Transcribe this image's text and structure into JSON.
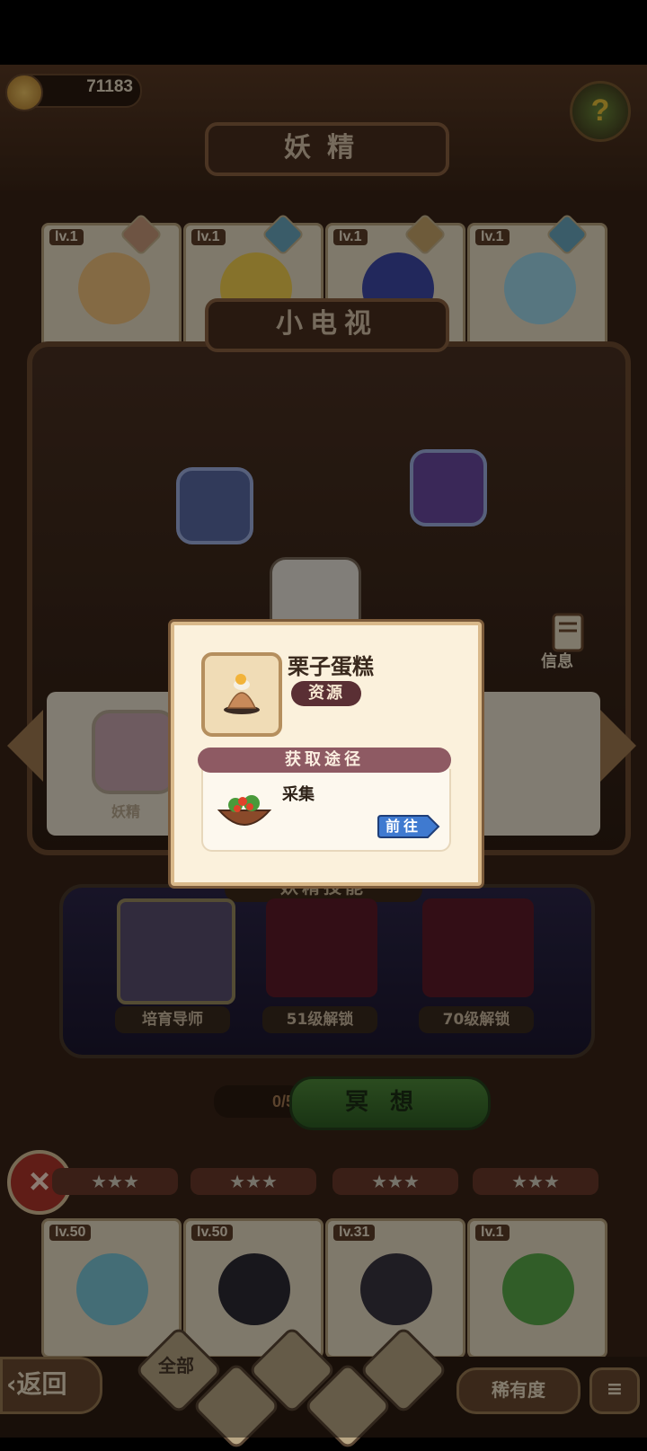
{
  "header": {
    "coins": "71183",
    "title": "妖精",
    "help_icon": "question-sprout-icon"
  },
  "top_cards": [
    {
      "level": "lv.1",
      "color": "#f1c27d"
    },
    {
      "level": "lv.1",
      "color": "#f4cf4f"
    },
    {
      "level": "lv.1",
      "color": "#3e4aa8"
    },
    {
      "level": "lv.1",
      "color": "#9fd8ea"
    }
  ],
  "room": {
    "title": "小电视",
    "info_label": "信息"
  },
  "left_panel": {
    "label": "妖精"
  },
  "skills": {
    "title": "妖精技能",
    "slots": [
      {
        "label": "培育导师"
      },
      {
        "label": "51级解锁"
      },
      {
        "label": "70级解锁"
      }
    ]
  },
  "meditate": {
    "counter": "0/5",
    "label": "冥想"
  },
  "bottom_cards": [
    {
      "level": "lv.50",
      "color": "#7cc6d8"
    },
    {
      "level": "lv.50",
      "color": "#2c2a33"
    },
    {
      "level": "lv.31",
      "color": "#3a3540"
    },
    {
      "level": "lv.1",
      "color": "#5aa94a"
    }
  ],
  "stars": "★★★",
  "bottom_bar": {
    "back_label": "返回",
    "all_label": "全部",
    "rarity_label": "稀有度",
    "sort_icon": "sort-icon"
  },
  "popup": {
    "item_name": "栗子蛋糕",
    "item_tag": "资源",
    "route_header": "获取途径",
    "route_name": "采集",
    "go_label": "前往"
  }
}
